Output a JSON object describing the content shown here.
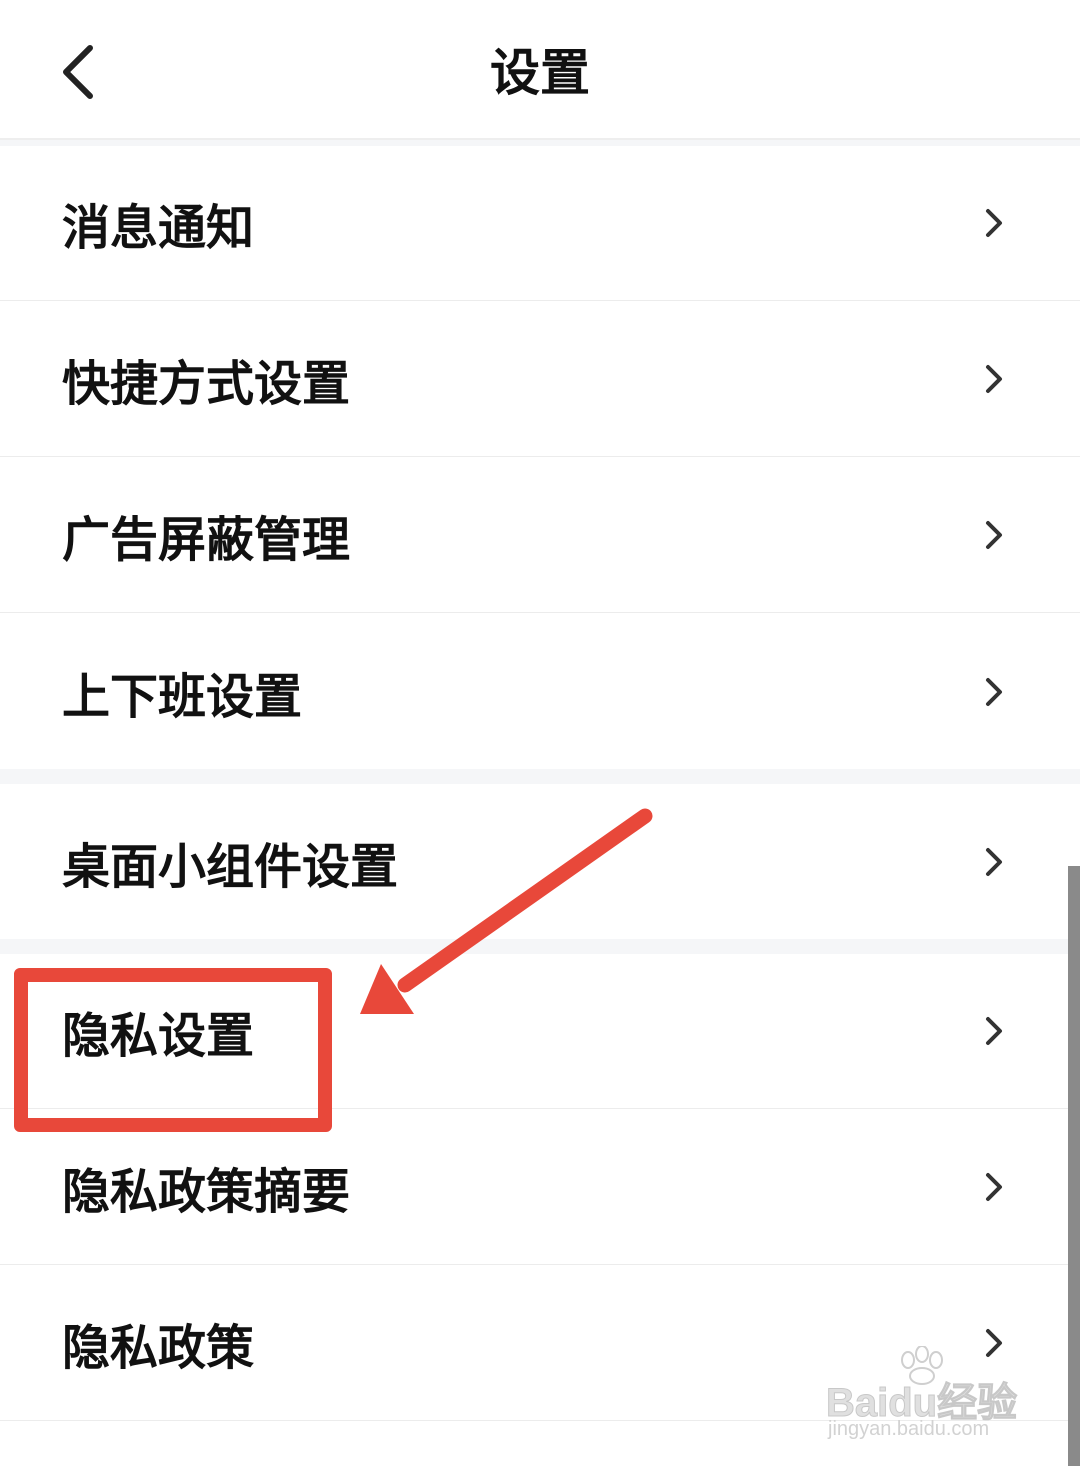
{
  "header": {
    "title": "设置",
    "back_icon": "chevron-left-icon"
  },
  "settings": {
    "items": [
      {
        "label": "消息通知",
        "icon": "chevron-right-icon"
      },
      {
        "label": "快捷方式设置",
        "icon": "chevron-right-icon"
      },
      {
        "label": "广告屏蔽管理",
        "icon": "chevron-right-icon"
      },
      {
        "label": "上下班设置",
        "icon": "chevron-right-icon"
      },
      {
        "label": "桌面小组件设置",
        "icon": "chevron-right-icon"
      },
      {
        "label": "隐私设置",
        "icon": "chevron-right-icon"
      },
      {
        "label": "隐私政策摘要",
        "icon": "chevron-right-icon"
      },
      {
        "label": "隐私政策",
        "icon": "chevron-right-icon"
      }
    ]
  },
  "annotation": {
    "highlighted_item": "隐私设置",
    "color": "#e8483a"
  },
  "watermark": {
    "logo": "Baidu经验",
    "url": "jingyan.baidu.com"
  },
  "colors": {
    "background": "#ffffff",
    "section_gap": "#f5f6f8",
    "text": "#111111",
    "chevron": "#333333"
  }
}
